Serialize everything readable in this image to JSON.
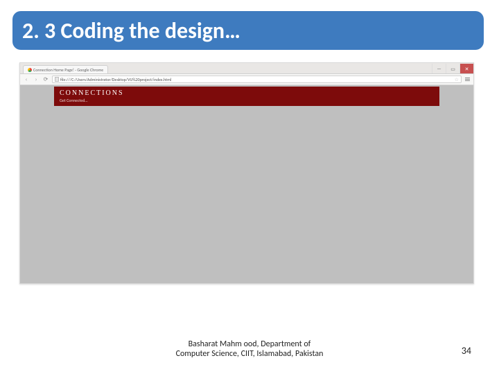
{
  "slide": {
    "title": "2. 3 Coding the design…",
    "page_number": "34",
    "footer_line1": "Basharat Mahm ood, Department of",
    "footer_line2": "Computer Science, CIIT, Islamabad, Pakistan"
  },
  "browser": {
    "tab_title": "Connection Home Page! - Google Chrome",
    "address": "file:///C:/Users/Administrator/Desktop/VU%20project/index.html",
    "window_controls": {
      "min": "—",
      "max": "▭",
      "close": "✕"
    },
    "nav": {
      "back": "‹",
      "forward": "›",
      "reload": "⟳"
    },
    "star": "☆"
  },
  "page_content": {
    "logo_text": "CONNECTIONS",
    "tagline": "Get Connected…"
  }
}
